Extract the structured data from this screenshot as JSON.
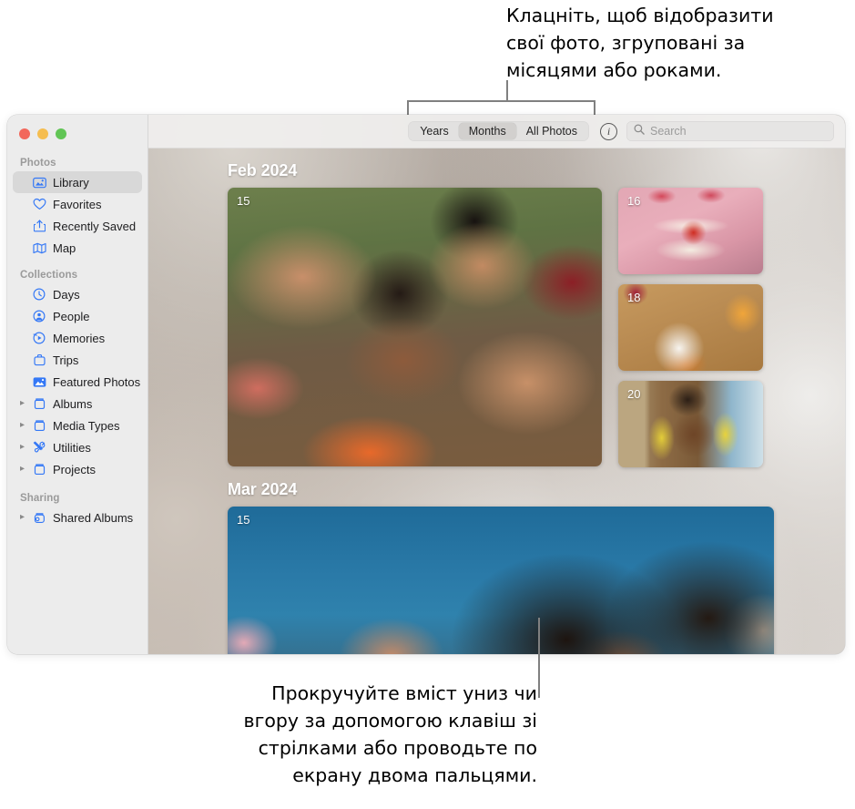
{
  "callouts": {
    "top": "Клацніть, щоб відобразити\nсвої фото, згруповані за\nмісяцями або роками.",
    "bottom": "Прокручуйте вміст униз чи\nвгору за допомогою клавіш зі\nстрілками або проводьте по\nекрану двома пальцями."
  },
  "window": {
    "traffic_lights": [
      "close",
      "minimize",
      "zoom"
    ]
  },
  "sidebar": {
    "sections": [
      {
        "title": "Photos",
        "items": [
          {
            "label": "Library",
            "icon": "library-icon",
            "selected": true,
            "disclosure": false
          },
          {
            "label": "Favorites",
            "icon": "heart-icon",
            "selected": false,
            "disclosure": false
          },
          {
            "label": "Recently Saved",
            "icon": "recently-saved-icon",
            "selected": false,
            "disclosure": false
          },
          {
            "label": "Map",
            "icon": "map-icon",
            "selected": false,
            "disclosure": false
          }
        ]
      },
      {
        "title": "Collections",
        "items": [
          {
            "label": "Days",
            "icon": "clock-icon",
            "selected": false,
            "disclosure": false
          },
          {
            "label": "People",
            "icon": "person-icon",
            "selected": false,
            "disclosure": false
          },
          {
            "label": "Memories",
            "icon": "memories-icon",
            "selected": false,
            "disclosure": false
          },
          {
            "label": "Trips",
            "icon": "trips-icon",
            "selected": false,
            "disclosure": false
          },
          {
            "label": "Featured Photos",
            "icon": "featured-photos-icon",
            "selected": false,
            "disclosure": false
          },
          {
            "label": "Albums",
            "icon": "album-icon",
            "selected": false,
            "disclosure": true
          },
          {
            "label": "Media Types",
            "icon": "album-icon",
            "selected": false,
            "disclosure": true
          },
          {
            "label": "Utilities",
            "icon": "utilities-icon",
            "selected": false,
            "disclosure": true
          },
          {
            "label": "Projects",
            "icon": "album-icon",
            "selected": false,
            "disclosure": true
          }
        ]
      },
      {
        "title": "Sharing",
        "items": [
          {
            "label": "Shared Albums",
            "icon": "shared-album-icon",
            "selected": false,
            "disclosure": true
          }
        ]
      }
    ]
  },
  "toolbar": {
    "segments": [
      {
        "label": "Years",
        "active": false
      },
      {
        "label": "Months",
        "active": true
      },
      {
        "label": "All Photos",
        "active": false
      }
    ],
    "info_label": "i",
    "search_placeholder": "Search"
  },
  "library": {
    "months": [
      {
        "header": "Feb 2024",
        "hero": {
          "day": "15",
          "art": "art-selfie"
        },
        "thumbnails": [
          {
            "day": "16",
            "art": "art-cake"
          },
          {
            "day": "18",
            "art": "art-plate"
          },
          {
            "day": "20",
            "art": "art-portrait"
          }
        ]
      },
      {
        "header": "Mar 2024",
        "hero": {
          "day": "15",
          "art": "art-blue"
        },
        "thumbnails": []
      }
    ]
  },
  "colors": {
    "accent": "#3478f6",
    "sidebar_bg": "#ececec",
    "selected_row": "#d8d8d8",
    "traffic_red": "#f2675b",
    "traffic_yellow": "#f5bd4f",
    "traffic_green": "#61c555",
    "callout_line": "#808080"
  }
}
